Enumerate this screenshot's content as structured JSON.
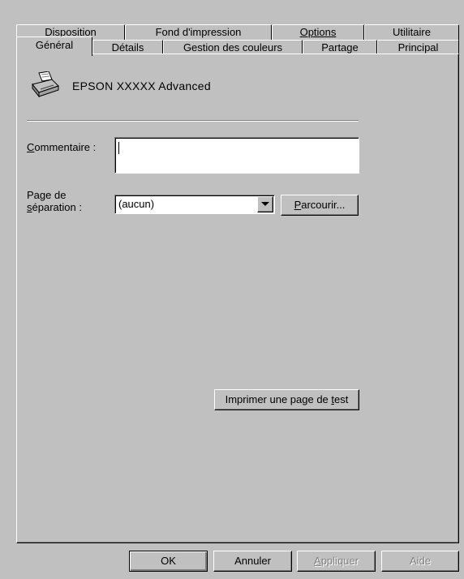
{
  "tabs_back": [
    {
      "label": "Disposition"
    },
    {
      "label": "Fond d'impression"
    },
    {
      "label": "Options"
    },
    {
      "label": "Utilitaire"
    }
  ],
  "tabs_front": [
    {
      "label": "Général"
    },
    {
      "label": "Détails"
    },
    {
      "label": "Gestion des couleurs"
    },
    {
      "label": "Partage"
    },
    {
      "label": "Principal"
    }
  ],
  "printer": {
    "icon": "printer-icon",
    "name": "EPSON XXXXX Advanced"
  },
  "comment": {
    "label_first": "C",
    "label_rest": "ommentaire :",
    "value": ""
  },
  "separator": {
    "label_line1": "Page de",
    "label_line2_first": "s",
    "label_line2_rest": "éparation :",
    "value": "(aucun)"
  },
  "browse": {
    "first": "P",
    "rest": "arcourir..."
  },
  "test_page": {
    "pre": "Imprimer une page de ",
    "underlined": "t",
    "post": "est"
  },
  "footer": {
    "ok": "OK",
    "cancel": "Annuler",
    "apply_first": "A",
    "apply_rest": "ppliquer",
    "help": "Aide"
  }
}
